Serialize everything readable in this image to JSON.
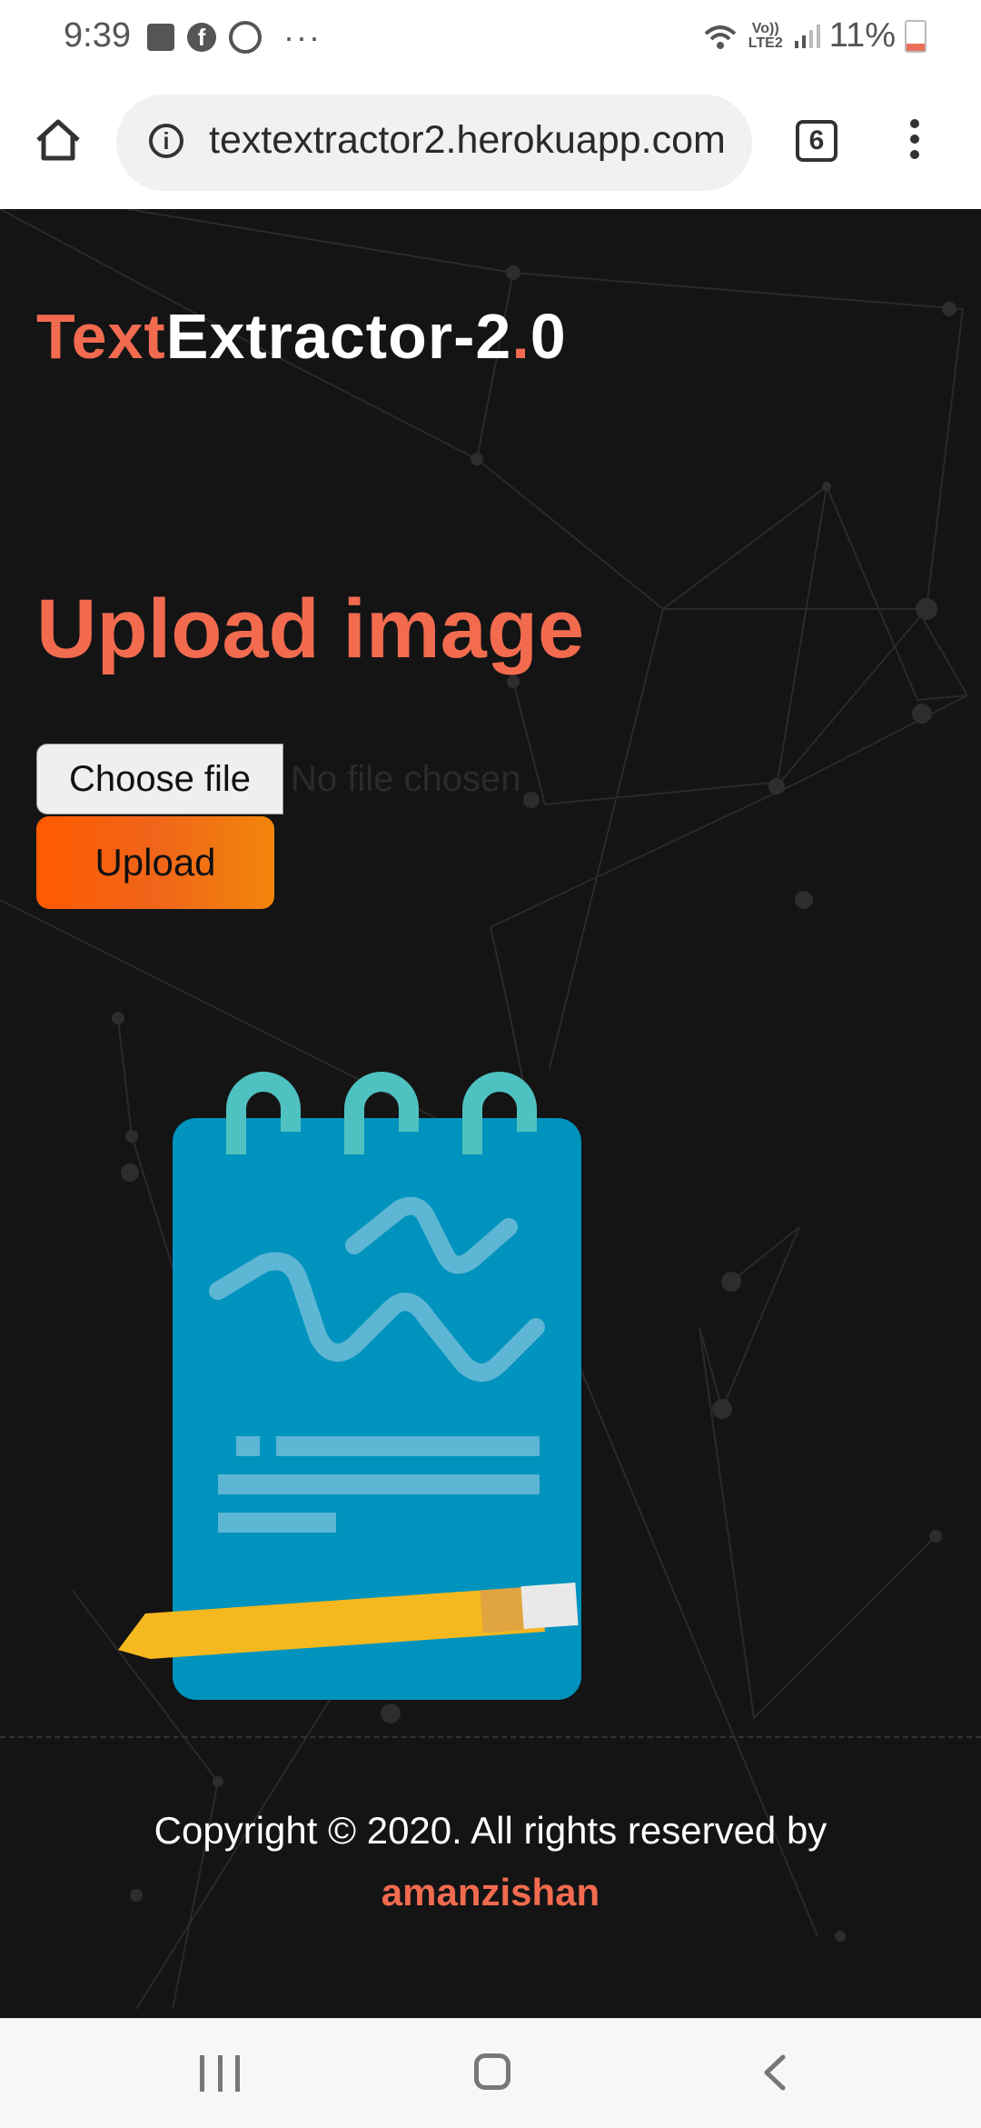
{
  "status_bar": {
    "time": "9:39",
    "more_indicator": "···",
    "network_label": "Vo)) LTE2",
    "battery_text": "11%",
    "icons": [
      "image-icon",
      "facebook-icon",
      "sync-icon",
      "wifi-icon",
      "signal-icon",
      "battery-icon"
    ]
  },
  "browser": {
    "url": "textextractor2.herokuapp.com",
    "tab_count": "6"
  },
  "site": {
    "title_accent": "Text",
    "title_main": "Extractor-2",
    "title_dot": ".",
    "title_end": "0"
  },
  "upload": {
    "heading": "Upload image",
    "choose_file_label": "Choose file",
    "no_file_text": "No file chosen",
    "upload_button": "Upload"
  },
  "footer": {
    "copyright": "Copyright © 2020. All rights reserved by",
    "author": "amanzishan"
  },
  "colors": {
    "accent": "#f26b4f",
    "background": "#141415",
    "upload_gradient_start": "#ff5a00",
    "upload_gradient_end": "#f2860b",
    "notepad": "#0093bd",
    "rings": "#4fc1c1",
    "pencil": "#f5b81f"
  }
}
